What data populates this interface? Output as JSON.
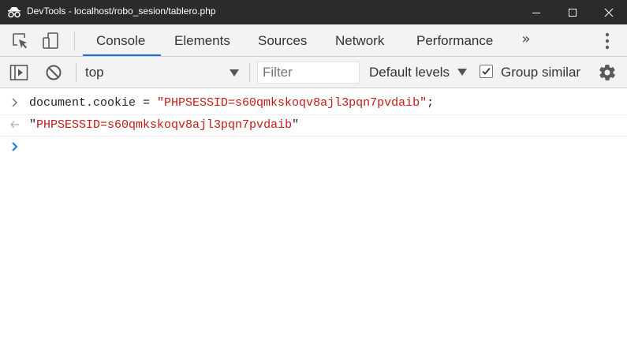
{
  "window": {
    "title": "DevTools - localhost/robo_sesion/tablero.php",
    "icons": [
      "devtools-icon",
      "minimize-icon",
      "maximize-icon",
      "close-icon"
    ]
  },
  "tabs": {
    "items": [
      {
        "label": "Console",
        "active": true
      },
      {
        "label": "Elements",
        "active": false
      },
      {
        "label": "Sources",
        "active": false
      },
      {
        "label": "Network",
        "active": false
      },
      {
        "label": "Performance",
        "active": false
      }
    ],
    "more_label": "»",
    "accent_color": "#1a73e8",
    "icons": [
      "inspect-element-icon",
      "device-toolbar-icon",
      "more-tabs-icon",
      "kebab-menu-icon"
    ]
  },
  "console_toolbar": {
    "context_value": "top",
    "filter_placeholder": "Filter",
    "levels_label": "Default levels",
    "group_similar_label": "Group similar",
    "group_similar_checked": true,
    "icons": [
      "show-sidebar-icon",
      "clear-console-icon",
      "settings-gear-icon"
    ]
  },
  "console": {
    "input_line": {
      "code": "document.cookie = ",
      "string": "\"PHPSESSID=s60qmkskoqv8ajl3pqn7pvdaib\"",
      "terminator": ";"
    },
    "result_line": {
      "string_open": "\"",
      "string_value": "PHPSESSID=s60qmkskoqv8ajl3pqn7pvdaib",
      "string_close": "\""
    },
    "string_color": "#c41a16",
    "prompt_color": "#1a73e8"
  }
}
